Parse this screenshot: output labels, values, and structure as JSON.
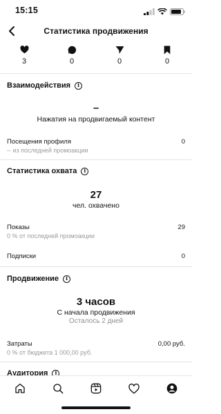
{
  "status_bar": {
    "time": "15:15"
  },
  "header": {
    "title": "Статистика продвижения"
  },
  "stats": {
    "likes": "3",
    "comments": "0",
    "shares": "0",
    "saves": "0"
  },
  "interactions": {
    "title": "Взаимодействия",
    "value": "–",
    "label": "Нажатия на продвигаемый контент",
    "profile_visits_label": "Посещения профиля",
    "profile_visits_value": "0",
    "profile_visits_sub": "-- из последней промоакции"
  },
  "reach": {
    "title": "Статистика охвата",
    "value": "27",
    "label": "чел. охвачено",
    "impressions_label": "Показы",
    "impressions_value": "29",
    "impressions_sub": "0 % от последней промоакции",
    "follows_label": "Подписки",
    "follows_value": "0"
  },
  "promotion": {
    "title": "Продвижение",
    "value": "3 часов",
    "label": "С начала продвижения",
    "remaining": "Осталось 2 дней",
    "spend_label": "Затраты",
    "spend_value": "0,00 руб.",
    "spend_sub": "0 % от бюджета 1 000,00 руб."
  },
  "audience": {
    "title": "Аудитория"
  }
}
